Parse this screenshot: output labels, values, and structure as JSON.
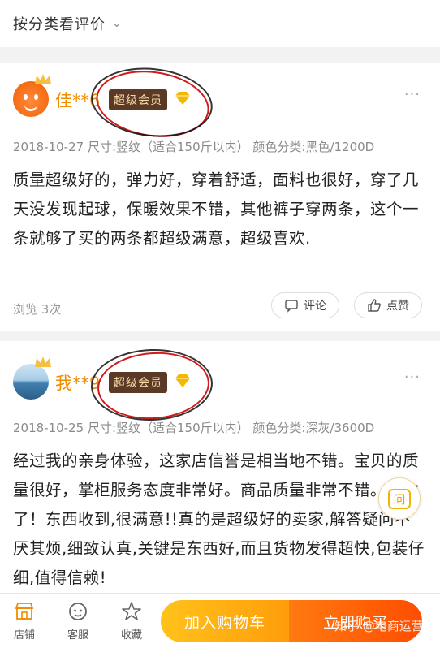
{
  "header": {
    "title": "按分类看评价",
    "chevron": "⌄"
  },
  "reviews": [
    {
      "username": "佳**6",
      "badge": "超级会员",
      "meta": "2018-10-27 尺寸:竖纹（适合150斤以内） 颜色分类:黑色/1200D",
      "text": "质量超级好的，弹力好，穿着舒适，面料也很好，穿了几天没发现起球，保暖效果不错，其他裤子穿两条，这个一条就够了买的两条都超级满意，超级喜欢.",
      "views": "浏览 3次",
      "comment_label": "评论",
      "like_label": "点赞"
    },
    {
      "username": "我**9",
      "badge": "超级会员",
      "meta": "2018-10-25 尺寸:竖纹（适合150斤以内） 颜色分类:深灰/3600D",
      "text": "经过我的亲身体验，这家店信誉是相当地不错。宝贝的质量很好，掌柜服务态度非常好。商品质量非常不错。顶你了！东西收到,很满意!!真的是超级好的卖家,解答疑问不厌其烦,细致认真,关键是东西好,而且货物发得超快,包装仔细,值得信赖!"
    }
  ],
  "ask_button": "问",
  "bottom_bar": {
    "store": "店铺",
    "service": "客服",
    "favorite": "收藏",
    "add_to_cart": "加入购物车",
    "buy_now": "立即购买"
  },
  "watermark": "知乎 @电商运营",
  "colors": {
    "accent": "#f08c00",
    "vip_badge_bg": "#5a3a26",
    "buy": "#ff5a00",
    "cart": "#ffb015"
  }
}
